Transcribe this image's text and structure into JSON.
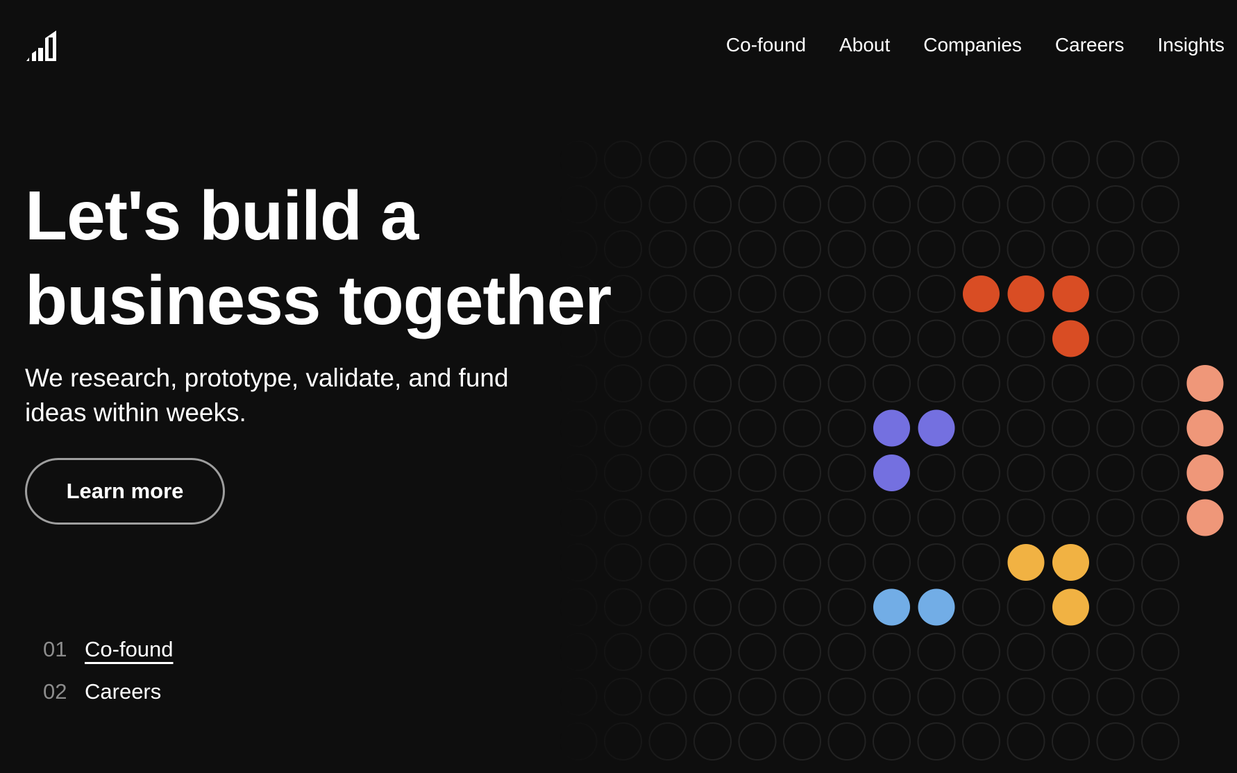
{
  "brand": {
    "logo_name": "bar-chart-logo-icon"
  },
  "nav": {
    "items": [
      {
        "label": "Co-found"
      },
      {
        "label": "About"
      },
      {
        "label": "Companies"
      },
      {
        "label": "Careers"
      },
      {
        "label": "Insights"
      }
    ]
  },
  "hero": {
    "headline_line1": "Let's build a",
    "headline_line2": "business together",
    "subhead": "We research, prototype, validate, and fund ideas within weeks.",
    "cta_label": "Learn more"
  },
  "steps": [
    {
      "number": "01",
      "label": "Co-found",
      "active": true
    },
    {
      "number": "02",
      "label": "Careers",
      "active": false
    }
  ],
  "theme": {
    "background": "#0e0e0e",
    "text": "#ffffff",
    "muted": "#8c8c8c",
    "dot_outline": "#222222",
    "accents": {
      "red": "#d94d24",
      "salmon": "#ef9779",
      "purple": "#7470e0",
      "yellow": "#f1b243",
      "blue": "#72ade6"
    }
  },
  "dot_pattern": [
    {
      "color_key": "red",
      "cells": [
        [
          7,
          3
        ],
        [
          8,
          3
        ],
        [
          9,
          3
        ],
        [
          9,
          4
        ]
      ]
    },
    {
      "color_key": "salmon",
      "cells": [
        [
          12,
          5
        ],
        [
          12,
          6
        ],
        [
          12,
          7
        ],
        [
          12,
          8
        ]
      ]
    },
    {
      "color_key": "purple",
      "cells": [
        [
          5,
          6
        ],
        [
          6,
          6
        ],
        [
          5,
          7
        ]
      ]
    },
    {
      "color_key": "yellow",
      "cells": [
        [
          8,
          9
        ],
        [
          9,
          9
        ],
        [
          9,
          10
        ]
      ]
    },
    {
      "color_key": "blue",
      "cells": [
        [
          5,
          10
        ],
        [
          6,
          10
        ]
      ]
    }
  ]
}
